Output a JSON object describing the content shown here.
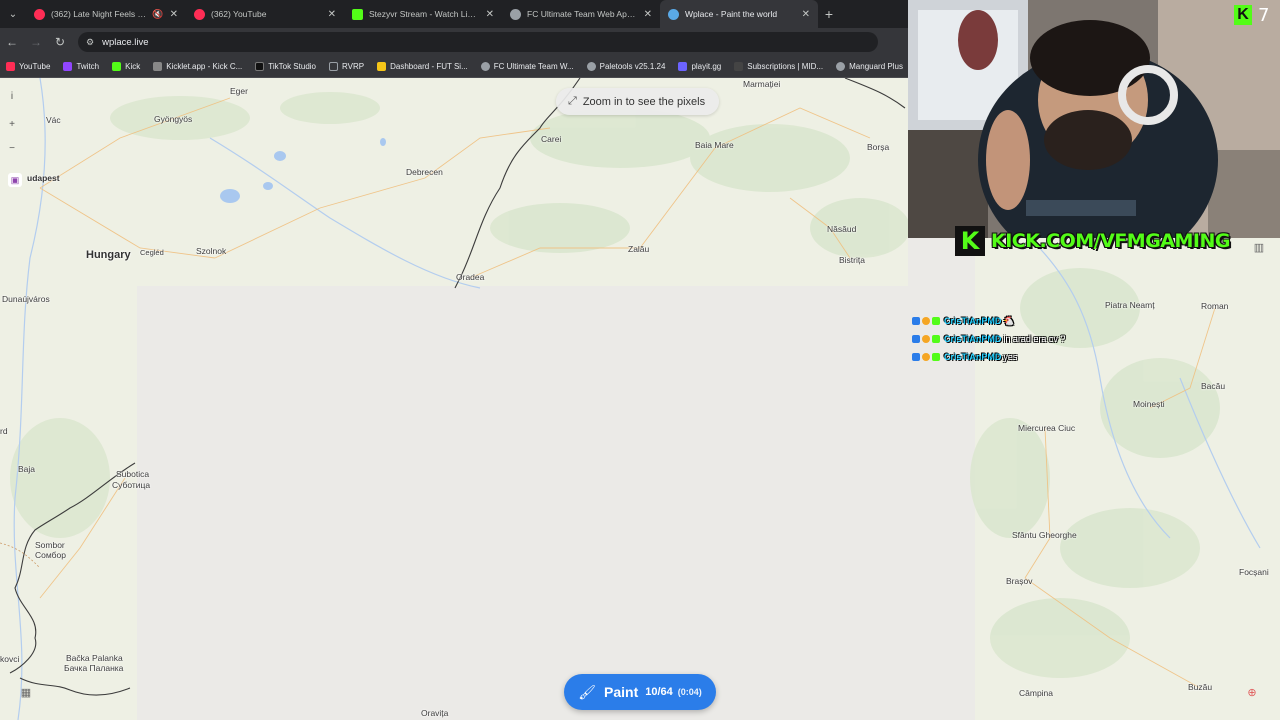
{
  "browser": {
    "tabs": [
      {
        "label": "(362) Late Night Feels Playl",
        "color": "#ff2d55",
        "muted": true
      },
      {
        "label": "(362) YouTube",
        "color": "#ff2d55",
        "muted": false
      },
      {
        "label": "Stezyvr Stream - Watch Live on",
        "color": "#53fc18",
        "muted": false
      },
      {
        "label": "FC Ultimate Team Web App - E",
        "color": "#9aa0a6",
        "muted": false
      },
      {
        "label": "Wplace - Paint the world",
        "color": "#5aa9e6",
        "muted": false,
        "active": true
      }
    ],
    "url": "wplace.live",
    "bookmarks": [
      {
        "label": "YouTube",
        "color": "#ff2d55"
      },
      {
        "label": "Twitch",
        "color": "#9146ff"
      },
      {
        "label": "Kick",
        "color": "#53fc18"
      },
      {
        "label": "Kicklet.app - Kick C...",
        "color": "#888888"
      },
      {
        "label": "TikTok Studio",
        "color": "#111111"
      },
      {
        "label": "RVRP",
        "color": "#9aa0a6"
      },
      {
        "label": "Dashboard - FUT Si...",
        "color": "#f5c518"
      },
      {
        "label": "FC Ultimate Team W...",
        "color": "#9aa0a6"
      },
      {
        "label": "Paletools v25.1.24",
        "color": "#9aa0a6"
      },
      {
        "label": "playit.gg",
        "color": "#6c63ff"
      },
      {
        "label": "Subscriptions | MID...",
        "color": "#444444"
      },
      {
        "label": "Manguard Plus",
        "color": "#9aa0a6"
      }
    ]
  },
  "map": {
    "zoom_hint": "Zoom in to see the pixels",
    "places": [
      {
        "name": "Eger"
      },
      {
        "name": "Gyöngyös"
      },
      {
        "name": "Vác"
      },
      {
        "name": "udapest"
      },
      {
        "name": "Debrecen"
      },
      {
        "name": "Carei"
      },
      {
        "name": "Baia Mare"
      },
      {
        "name": "Borșa"
      },
      {
        "name": "Năsăud"
      },
      {
        "name": "Bistrița"
      },
      {
        "name": "Zalău"
      },
      {
        "name": "Oradea"
      },
      {
        "name": "Szolnok"
      },
      {
        "name": "Cegléd"
      },
      {
        "name": "Hungary"
      },
      {
        "name": "Dunaújváros"
      },
      {
        "name": "Subotica"
      },
      {
        "name": "Суботица"
      },
      {
        "name": "Baja"
      },
      {
        "name": "Sombor"
      },
      {
        "name": "Сомбор"
      },
      {
        "name": "Bačka Palanka"
      },
      {
        "name": "Бачка Паланка"
      },
      {
        "name": "kovci"
      },
      {
        "name": "rd"
      },
      {
        "name": "Piatra Neamț"
      },
      {
        "name": "Roman"
      },
      {
        "name": "Bacău"
      },
      {
        "name": "Moinești"
      },
      {
        "name": "Miercurea Ciuc"
      },
      {
        "name": "Sfântu Gheorghe"
      },
      {
        "name": "Brașov"
      },
      {
        "name": "Focșani"
      },
      {
        "name": "Câmpina"
      },
      {
        "name": "Buzău"
      },
      {
        "name": "Oravița"
      },
      {
        "name": "Marmației"
      }
    ],
    "paint_button": {
      "label": "Paint",
      "count": "10/64",
      "timer": "(0:04)"
    }
  },
  "stream": {
    "kick_url": "KICK.COM/VFMGAMING",
    "kick_logo": "K",
    "viewer_count": "7",
    "chat": [
      {
        "user": "CrisTiAnPMD",
        "message": "🐔"
      },
      {
        "user": "CrisTiAnPMD",
        "message": "in arad era cv ?"
      },
      {
        "user": "CrisTiAnPMD",
        "message": "yes"
      }
    ]
  }
}
